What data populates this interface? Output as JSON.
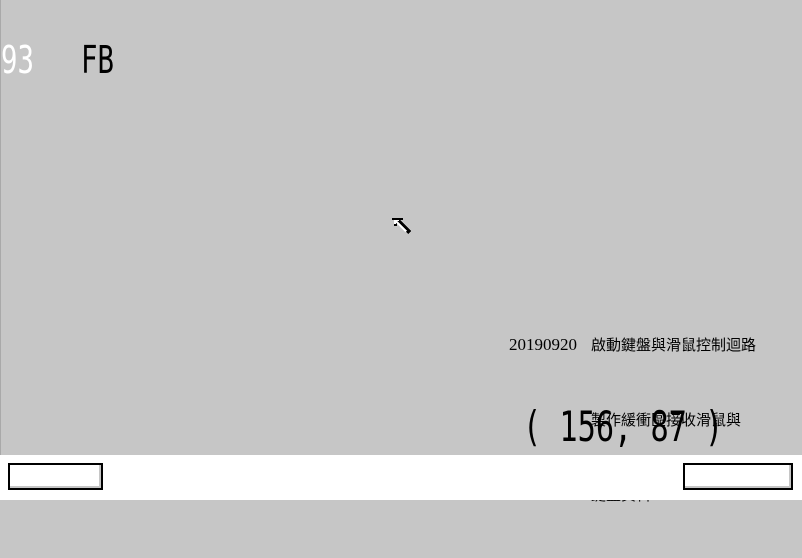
{
  "keyboard": {
    "previous_code": "93",
    "current_code": "FB"
  },
  "note": {
    "date": "20190920",
    "line1": "啟動鍵盤與滑鼠控制迴路",
    "line2": "製作緩衝區接收滑鼠與",
    "line3": "鍵盤資料"
  },
  "mouse": {
    "coordinates": "( 156, 87 )"
  },
  "icons": {
    "cursor": "mouse-pointer-icon"
  },
  "colors": {
    "background": "#c6c6c6",
    "statusbar": "#ffffff",
    "text": "#000000",
    "previous_code": "#ffffff"
  }
}
